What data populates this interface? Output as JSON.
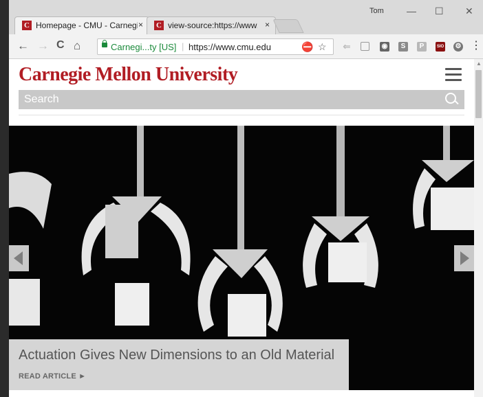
{
  "browser": {
    "tabs": [
      {
        "title": "Homepage - CMU - Carnegie Mellon University",
        "close": "×",
        "favicon": "C"
      },
      {
        "title": "view-source:https://www.cmu.edu",
        "close": "×",
        "favicon": "C"
      }
    ],
    "user": "Tom",
    "controls": {
      "minimize": "—",
      "maximize": "☐",
      "close": "✕"
    },
    "nav": {
      "back": "←",
      "forward": "→",
      "reload": "C",
      "home": "⌂"
    },
    "address": {
      "security_label": "Carnegi...ty [US]",
      "separator": "|",
      "url": "https://www.cmu.edu"
    },
    "menu": "⋮"
  },
  "page": {
    "logo": "Carnegie Mellon University",
    "search": {
      "placeholder": "Search"
    },
    "hero": {
      "caption": "Actuation Gives New Dimensions to an Old Material",
      "cta": "READ ARTICLE ►"
    }
  }
}
